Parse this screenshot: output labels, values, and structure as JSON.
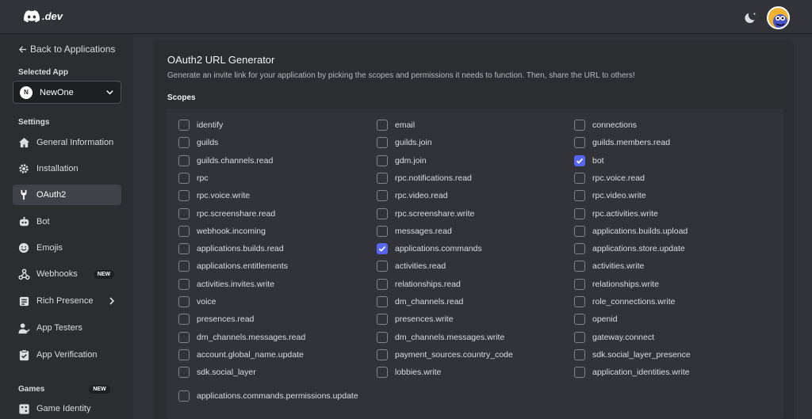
{
  "brand": {
    "logo_text": ".dev"
  },
  "sidebar": {
    "back_label": "Back to Applications",
    "selected_app_label": "Selected App",
    "app_badge": "N",
    "app_name": "NewOne",
    "settings_label": "Settings",
    "items": [
      {
        "label": "General Information",
        "icon": "home-icon"
      },
      {
        "label": "Installation",
        "icon": "gear-icon"
      },
      {
        "label": "OAuth2",
        "icon": "wrench-icon",
        "active": true
      },
      {
        "label": "Bot",
        "icon": "bot-icon"
      },
      {
        "label": "Emojis",
        "icon": "emoji-icon"
      },
      {
        "label": "Webhooks",
        "icon": "webhook-icon",
        "badge": "NEW"
      },
      {
        "label": "Rich Presence",
        "icon": "presence-icon"
      },
      {
        "label": "App Testers",
        "icon": "testers-icon"
      },
      {
        "label": "App Verification",
        "icon": "verify-icon"
      }
    ],
    "games_label": "Games",
    "games_badge": "NEW",
    "game_identity": "Game Identity"
  },
  "main": {
    "title": "OAuth2 URL Generator",
    "description": "Generate an invite link for your application by picking the scopes and permissions it needs to function. Then, share the URL to others!",
    "scopes_label": "Scopes",
    "scopes": {
      "col1": [
        {
          "label": "identify",
          "checked": false
        },
        {
          "label": "guilds",
          "checked": false
        },
        {
          "label": "guilds.channels.read",
          "checked": false
        },
        {
          "label": "rpc",
          "checked": false
        },
        {
          "label": "rpc.voice.write",
          "checked": false
        },
        {
          "label": "rpc.screenshare.read",
          "checked": false
        },
        {
          "label": "webhook.incoming",
          "checked": false
        },
        {
          "label": "applications.builds.read",
          "checked": false
        },
        {
          "label": "applications.entitlements",
          "checked": false
        },
        {
          "label": "activities.invites.write",
          "checked": false
        },
        {
          "label": "voice",
          "checked": false
        },
        {
          "label": "presences.read",
          "checked": false
        },
        {
          "label": "dm_channels.messages.read",
          "checked": false
        },
        {
          "label": "account.global_name.update",
          "checked": false
        },
        {
          "label": "sdk.social_layer",
          "checked": false
        },
        {
          "label": "applications.commands.permissions.update",
          "checked": false
        }
      ],
      "col2": [
        {
          "label": "email",
          "checked": false
        },
        {
          "label": "guilds.join",
          "checked": false
        },
        {
          "label": "gdm.join",
          "checked": false
        },
        {
          "label": "rpc.notifications.read",
          "checked": false
        },
        {
          "label": "rpc.video.read",
          "checked": false
        },
        {
          "label": "rpc.screenshare.write",
          "checked": false
        },
        {
          "label": "messages.read",
          "checked": false
        },
        {
          "label": "applications.commands",
          "checked": true
        },
        {
          "label": "activities.read",
          "checked": false
        },
        {
          "label": "relationships.read",
          "checked": false
        },
        {
          "label": "dm_channels.read",
          "checked": false
        },
        {
          "label": "presences.write",
          "checked": false
        },
        {
          "label": "dm_channels.messages.write",
          "checked": false
        },
        {
          "label": "payment_sources.country_code",
          "checked": false
        },
        {
          "label": "lobbies.write",
          "checked": false
        }
      ],
      "col3": [
        {
          "label": "connections",
          "checked": false
        },
        {
          "label": "guilds.members.read",
          "checked": false
        },
        {
          "label": "bot",
          "checked": true
        },
        {
          "label": "rpc.voice.read",
          "checked": false
        },
        {
          "label": "rpc.video.write",
          "checked": false
        },
        {
          "label": "rpc.activities.write",
          "checked": false
        },
        {
          "label": "applications.builds.upload",
          "checked": false
        },
        {
          "label": "applications.store.update",
          "checked": false
        },
        {
          "label": "activities.write",
          "checked": false
        },
        {
          "label": "relationships.write",
          "checked": false
        },
        {
          "label": "role_connections.write",
          "checked": false
        },
        {
          "label": "openid",
          "checked": false
        },
        {
          "label": "gateway.connect",
          "checked": false
        },
        {
          "label": "sdk.social_layer_presence",
          "checked": false
        },
        {
          "label": "application_identities.write",
          "checked": false
        }
      ]
    }
  }
}
